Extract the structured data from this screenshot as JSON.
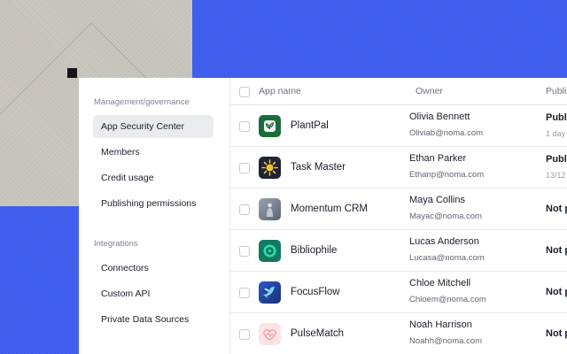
{
  "sidebar": {
    "sections": [
      {
        "label": "Management/governance",
        "items": [
          {
            "label": "App Security Center",
            "active": true
          },
          {
            "label": "Members",
            "active": false
          },
          {
            "label": "Credit usage",
            "active": false
          },
          {
            "label": "Publishing permissions",
            "active": false
          }
        ]
      },
      {
        "label": "Integrations",
        "items": [
          {
            "label": "Connectors",
            "active": false
          },
          {
            "label": "Custom API",
            "active": false
          },
          {
            "label": "Private Data Sources",
            "active": false
          }
        ]
      }
    ]
  },
  "table": {
    "headers": {
      "app": "App name",
      "owner": "Owner",
      "published": "Publi"
    },
    "rows": [
      {
        "icon": "plant-icon",
        "icon_bg": "#1c6b3d",
        "app": "PlantPal",
        "owner": "Olivia Bennett",
        "email": "Oliviab@noma.com",
        "published": "Publi",
        "published_sub": "1 day"
      },
      {
        "icon": "sun-icon",
        "icon_bg": "#1d2533",
        "app": "Task Master",
        "owner": "Ethan Parker",
        "email": "Ethanp@noma.com",
        "published": "Publi",
        "published_sub": "13/12"
      },
      {
        "icon": "figure-icon",
        "icon_bg": "#7a8392",
        "app": "Momentum CRM",
        "owner": "Maya Collins",
        "email": "Mayac@noma.com",
        "published": "Not p",
        "published_sub": ""
      },
      {
        "icon": "ring-icon",
        "icon_bg": "#0f7a63",
        "app": "Bibliophile",
        "owner": "Lucas Anderson",
        "email": "Lucasa@noma.com",
        "published": "Not p",
        "published_sub": ""
      },
      {
        "icon": "bird-icon",
        "icon_bg": "#1f3f8f",
        "app": "FocusFlow",
        "owner": "Chloe Mitchell",
        "email": "Chloem@noma.com",
        "published": "Not p",
        "published_sub": ""
      },
      {
        "icon": "heart-icon",
        "icon_bg": "#fbe3e6",
        "app": "PulseMatch",
        "owner": "Noah Harrison",
        "email": "Noahh@noma.com",
        "published": "Not p",
        "published_sub": ""
      }
    ]
  }
}
